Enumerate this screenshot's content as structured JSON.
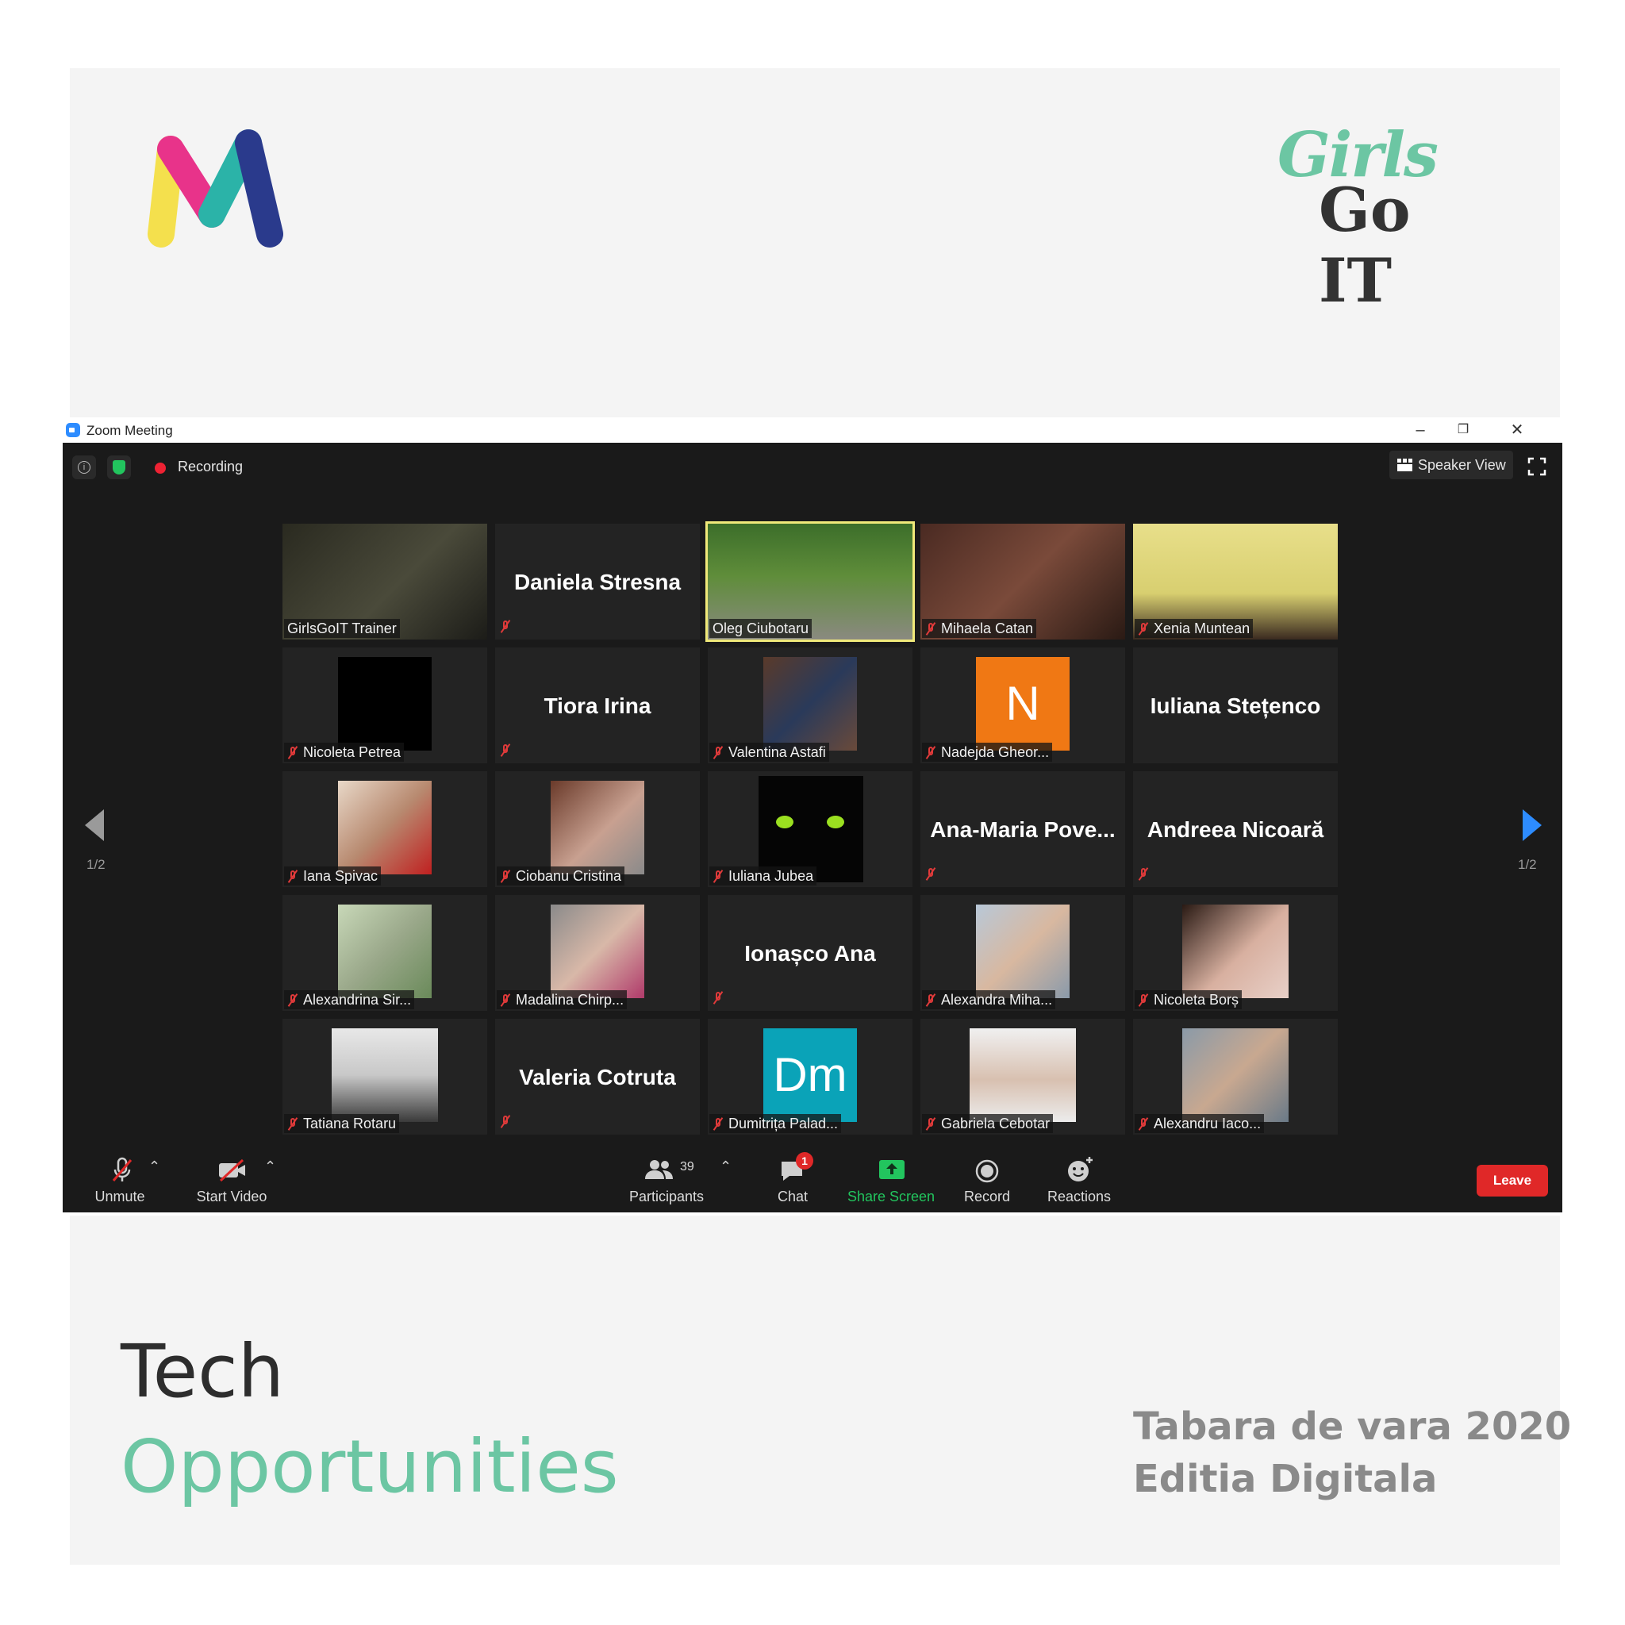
{
  "poster": {
    "title_line1": "Tech",
    "title_line2": "Opportunities",
    "camp_line1": "Tabara de vara 2020",
    "camp_line2": "Editia Digitala",
    "partner_logo_word1": "Girls",
    "partner_logo_word2": "Go IT",
    "accent_color": "#6cc6a3"
  },
  "window": {
    "title": "Zoom Meeting",
    "controls": [
      "minimize-icon",
      "restore-icon",
      "close-icon"
    ]
  },
  "topbar": {
    "recording_label": "Recording",
    "view_label": "Speaker View"
  },
  "pager": {
    "left": "1/2",
    "right": "1/2"
  },
  "participants": [
    {
      "name": "GirlsGoIT Trainer",
      "kind": "video",
      "muted": false
    },
    {
      "name": "Daniela Stresna",
      "kind": "name",
      "muted": true
    },
    {
      "name": "Oleg Ciubotaru",
      "kind": "video",
      "muted": false,
      "active": true
    },
    {
      "name": "Mihaela Catan",
      "kind": "video",
      "muted": true
    },
    {
      "name": "Xenia Muntean",
      "kind": "video",
      "muted": true
    },
    {
      "name": "Nicoleta Petrea",
      "kind": "photo",
      "muted": true
    },
    {
      "name": "Tiora Irina",
      "kind": "name",
      "muted": true
    },
    {
      "name": "Valentina Astafi",
      "kind": "photo",
      "muted": true
    },
    {
      "name": "Nadejda Gheor...",
      "kind": "letter",
      "letter": "N",
      "muted": true
    },
    {
      "name": "Iuliana Stețenco",
      "kind": "name",
      "muted": false
    },
    {
      "name": "Iana Spivac",
      "kind": "photo",
      "muted": true
    },
    {
      "name": "Ciobanu Cristina",
      "kind": "photo",
      "muted": true
    },
    {
      "name": "Iuliana Jubea",
      "kind": "photo",
      "muted": true
    },
    {
      "name": "Ana-Maria  Pove...",
      "kind": "name",
      "muted": true
    },
    {
      "name": "Andreea Nicoară",
      "kind": "name",
      "muted": true
    },
    {
      "name": "Alexandrina Sir...",
      "kind": "photo",
      "muted": true
    },
    {
      "name": "Madalina Chirp...",
      "kind": "photo",
      "muted": true
    },
    {
      "name": "Ionașco Ana",
      "kind": "name",
      "muted": true
    },
    {
      "name": "Alexandra Miha...",
      "kind": "photo",
      "muted": true
    },
    {
      "name": "Nicoleta Borș",
      "kind": "photo",
      "muted": true
    },
    {
      "name": "Tatiana Rotaru",
      "kind": "photo",
      "muted": true
    },
    {
      "name": "Valeria Cotruta",
      "kind": "name",
      "muted": true
    },
    {
      "name": "Dumitrița Palad...",
      "kind": "letter",
      "letter": "Dm",
      "muted": true
    },
    {
      "name": "Gabriela Cebotar",
      "kind": "photo",
      "muted": true
    },
    {
      "name": "Alexandru Iaco...",
      "kind": "photo",
      "muted": true
    }
  ],
  "toolbar": {
    "unmute": "Unmute",
    "start_video": "Start Video",
    "participants_count": "39",
    "participants": "Participants",
    "chat": "Chat",
    "chat_badge": "1",
    "share_screen": "Share Screen",
    "record": "Record",
    "reactions": "Reactions",
    "leave": "Leave"
  }
}
